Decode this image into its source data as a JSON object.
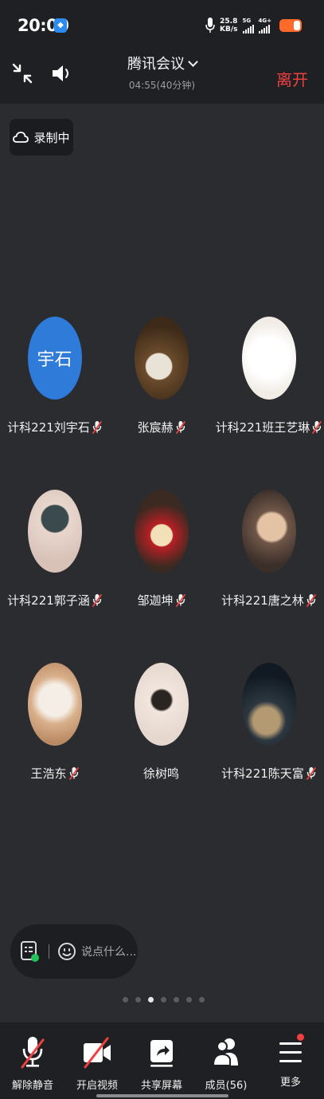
{
  "status": {
    "time": "20:00",
    "speed_value": "25.8",
    "speed_unit": "KB/s",
    "signal_1_label": "5G",
    "signal_2_label": "4G+"
  },
  "header": {
    "title": "腾讯会议",
    "subtitle": "04:55(40分钟)",
    "leave_label": "离开"
  },
  "recording": {
    "label": "录制中"
  },
  "participants": [
    {
      "name": "计科221刘宇石",
      "avatar_text": "宇石",
      "muted": true
    },
    {
      "name": "张宸赫",
      "muted": true
    },
    {
      "name": "计科221班王艺琳",
      "muted": true
    },
    {
      "name": "计科221郭子涵",
      "muted": true
    },
    {
      "name": "邹迦坤",
      "muted": true
    },
    {
      "name": "计科221唐之林",
      "muted": true
    },
    {
      "name": "王浩东",
      "muted": true
    },
    {
      "name": "徐树鸣",
      "muted": false
    },
    {
      "name": "计科221陈天富",
      "muted": true
    }
  ],
  "comment": {
    "placeholder": "说点什么..."
  },
  "pager": {
    "total": 7,
    "current": 3
  },
  "toolbar": {
    "unmute_label": "解除静音",
    "video_label": "开启视频",
    "share_label": "共享屏幕",
    "members_label": "成员(56)",
    "more_label": "更多"
  },
  "colors": {
    "leave": "#f0413f",
    "avatar_blue": "#2e7bd9",
    "battery": "#ff6a2a"
  }
}
